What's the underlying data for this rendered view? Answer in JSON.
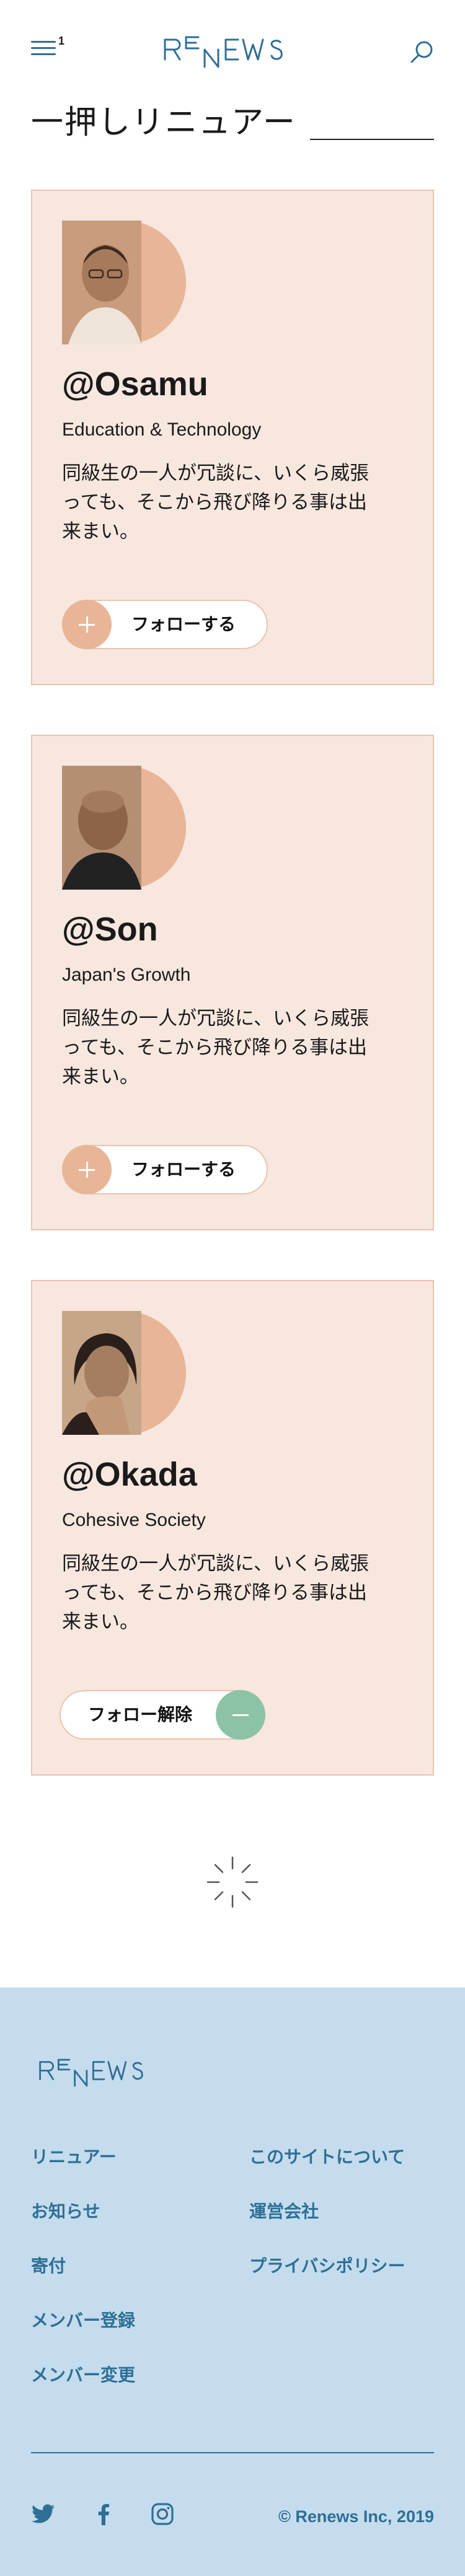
{
  "header": {
    "menu_badge": "1",
    "logo_text": "RENEWS",
    "page_title": "一押しリニュアー"
  },
  "colors": {
    "brand_blue": "#2f6f95",
    "card_bg": "#f7e7df",
    "card_border": "#ecc3ad",
    "follow_accent": "#e9b597",
    "unfollow_accent": "#8cc3a5",
    "footer_bg": "#c4dced"
  },
  "cards": [
    {
      "handle": "@Osamu",
      "category": "Education & Technology",
      "bio": "同級生の一人が冗談に、いくら威張っても、そこから飛び降りる事は出来まい。",
      "action_label": "フォローする",
      "action_state": "follow",
      "icon": "plus-icon"
    },
    {
      "handle": "@Son",
      "category": "Japan's Growth",
      "bio": "同級生の一人が冗談に、いくら威張っても、そこから飛び降りる事は出来まい。",
      "action_label": "フォローする",
      "action_state": "follow",
      "icon": "plus-icon"
    },
    {
      "handle": "@Okada",
      "category": "Cohesive Society",
      "bio": "同級生の一人が冗談に、いくら威張っても、そこから飛び降りる事は出来まい。",
      "action_label": "フォロー解除",
      "action_state": "unfollow",
      "icon": "minus-icon"
    }
  ],
  "footer": {
    "logo_text": "RENEWS",
    "links_left": [
      "リニュアー",
      "お知らせ",
      "寄付",
      "メンバー登録",
      "メンバー変更"
    ],
    "links_right": [
      "このサイトについて",
      "運営会社",
      "プライバシポリシー"
    ],
    "social": [
      "twitter-icon",
      "facebook-icon",
      "instagram-icon"
    ],
    "copyright": "© Renews Inc, 2019"
  }
}
